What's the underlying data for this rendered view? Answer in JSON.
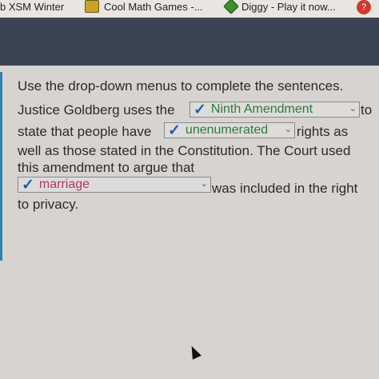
{
  "bookmarks": [
    {
      "label": "b XSM Winter"
    },
    {
      "label": "Cool Math Games -..."
    },
    {
      "label": "Diggy - Play it now..."
    }
  ],
  "instructions": "Use the drop-down menus to complete the sentences.",
  "sentence": {
    "part1": "Justice Goldberg uses the",
    "part2": "to",
    "part3": "state that people have",
    "part4": "rights as",
    "part5": "well as those stated in the Constitution. The Court used",
    "part6": "this amendment to argue that",
    "part7": "was included in the right",
    "part8": "to privacy."
  },
  "dropdowns": {
    "d1": {
      "value": "Ninth Amendment"
    },
    "d2": {
      "value": "unenumerated"
    },
    "d3": {
      "value": "marriage"
    }
  },
  "colors": {
    "check": "#1d5fa8",
    "correct_text": "#2e7a3c",
    "marriage_text": "#b03560"
  }
}
